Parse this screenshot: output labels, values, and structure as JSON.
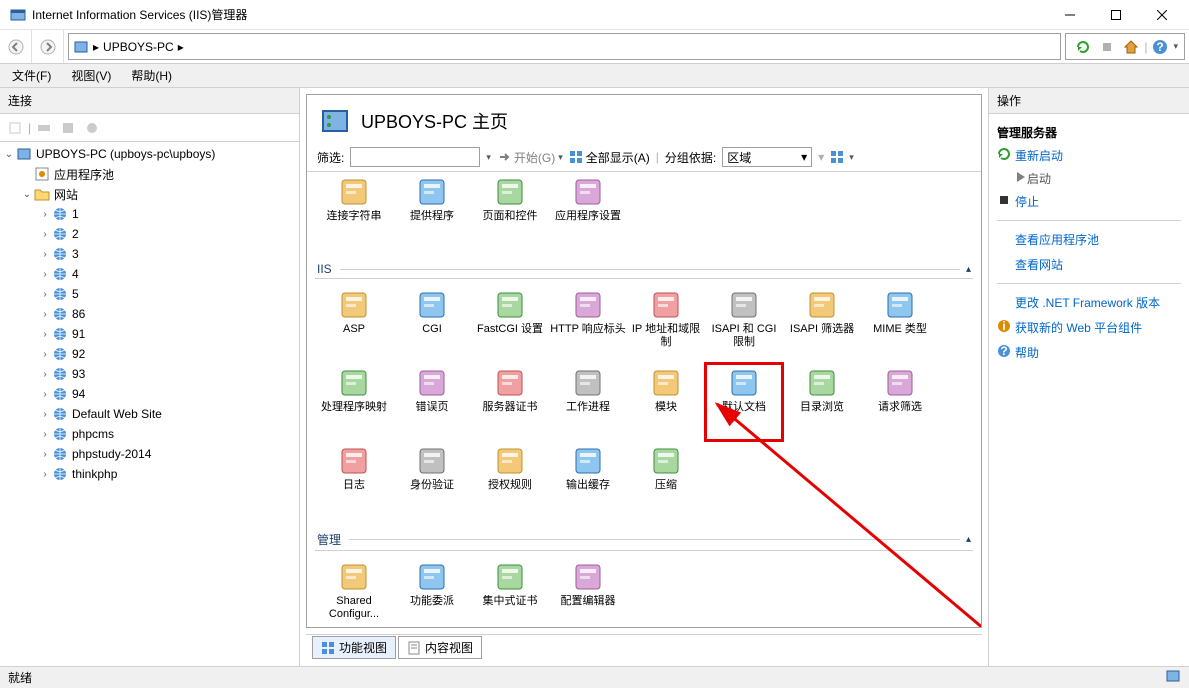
{
  "window": {
    "title": "Internet Information Services (IIS)管理器"
  },
  "address": {
    "host": "UPBOYS-PC"
  },
  "menu": {
    "file": "文件(F)",
    "view": "视图(V)",
    "help": "帮助(H)"
  },
  "panes": {
    "connections": "连接",
    "actions": "操作"
  },
  "tree": {
    "root": "UPBOYS-PC (upboys-pc\\upboys)",
    "app_pools": "应用程序池",
    "sites": "网站",
    "site_items": [
      "1",
      "2",
      "3",
      "4",
      "5",
      "86",
      "91",
      "92",
      "93",
      "94",
      "Default Web Site",
      "phpcms",
      "phpstudy-2014",
      "thinkphp"
    ]
  },
  "main": {
    "title": "UPBOYS-PC 主页",
    "filter_label": "筛选:",
    "start_label": "开始(G)",
    "show_all_label": "全部显示(A)",
    "group_by_label": "分组依据:",
    "group_by_value": "区域",
    "groups": {
      "iis": "IIS",
      "management": "管理"
    },
    "iis_features_top": [
      "连接字符串",
      "提供程序",
      "页面和控件",
      "应用程序设置"
    ],
    "iis_features": [
      "ASP",
      "CGI",
      "FastCGI 设置",
      "HTTP 响应标头",
      "IP 地址和域限制",
      "ISAPI 和 CGI 限制",
      "ISAPI 筛选器",
      "MIME 类型",
      "处理程序映射",
      "错误页",
      "服务器证书",
      "工作进程",
      "模块",
      "默认文档",
      "目录浏览",
      "请求筛选",
      "日志",
      "身份验证",
      "授权规则",
      "输出缓存",
      "压缩"
    ],
    "mgmt_features": [
      "Shared Configur...",
      "功能委派",
      "集中式证书",
      "配置编辑器"
    ],
    "highlighted_feature": "默认文档",
    "view_tabs": {
      "features": "功能视图",
      "content": "内容视图"
    }
  },
  "actions": {
    "manage_server": "管理服务器",
    "restart": "重新启动",
    "start": "启动",
    "stop": "停止",
    "view_app_pools": "查看应用程序池",
    "view_sites": "查看网站",
    "change_framework": "更改 .NET Framework 版本",
    "get_webpi": "获取新的 Web 平台组件",
    "help": "帮助"
  },
  "status": {
    "ready": "就绪"
  }
}
